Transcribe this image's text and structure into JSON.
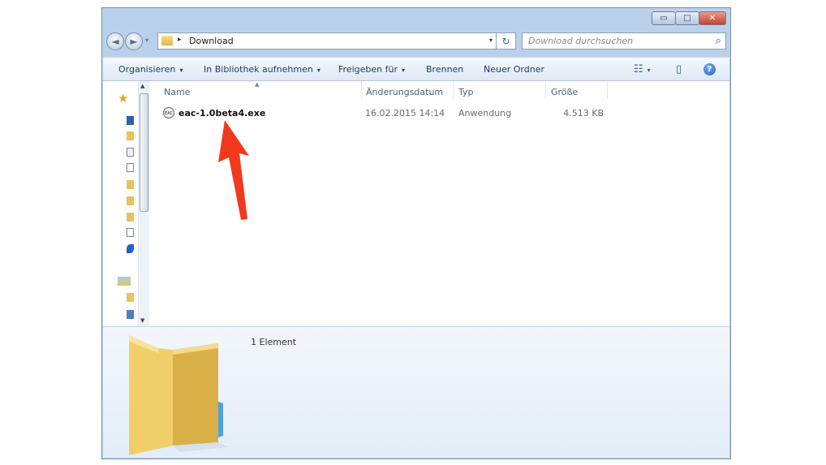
{
  "window": {
    "minimize": "▭",
    "maximize": "□",
    "close": "✕"
  },
  "address": {
    "path": [
      "Download"
    ],
    "separator": "▸",
    "dropdown": "▾",
    "refresh_icon": "↻",
    "back_icon": "◄",
    "forward_icon": "►"
  },
  "search": {
    "placeholder": "Download durchsuchen",
    "icon": "⌕"
  },
  "toolbar": {
    "organize": "Organisieren",
    "include_library": "In Bibliothek aufnehmen",
    "share": "Freigeben für",
    "burn": "Brennen",
    "new_folder": "Neuer Ordner",
    "caret": "▾",
    "view_icon": "☷",
    "preview_icon": "▯",
    "help": "?"
  },
  "columns": {
    "name": "Name",
    "modified": "Änderungsdatum",
    "type": "Typ",
    "size": "Größe"
  },
  "files": [
    {
      "icon_label": "EAC",
      "name": "eac-1.0beta4.exe",
      "modified": "16.02.2015 14:14",
      "type": "Anwendung",
      "size": "4.513 KB"
    }
  ],
  "details": {
    "item_count": "1 Element"
  },
  "colors": {
    "frame": "#b9d1ea",
    "annotation_arrow": "#f2391d",
    "folder": "#f0cf6b"
  },
  "icons": {
    "favorites": "star-icon",
    "annotation": "red-arrow-icon"
  }
}
